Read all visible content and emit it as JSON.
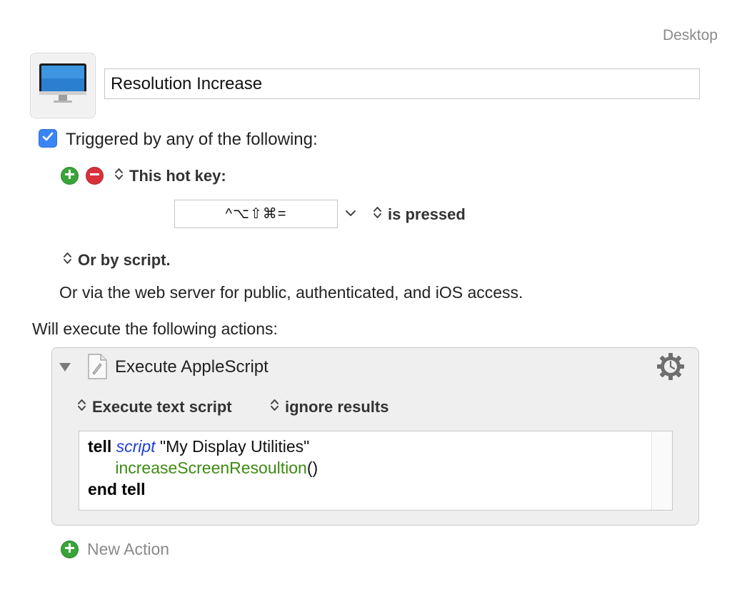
{
  "group": {
    "label": "Desktop"
  },
  "macro": {
    "name": "Resolution Increase",
    "icon": "monitor-icon"
  },
  "trigger": {
    "enabled": true,
    "label": "Triggered by any of the following:",
    "type_label": "This hot key:",
    "hotkey": "^⌥⇧⌘=",
    "condition_label": "is pressed",
    "script_label": "Or by script.",
    "webserver_text": "Or via the web server for public, authenticated, and iOS access."
  },
  "actions": {
    "label": "Will execute the following actions:",
    "items": [
      {
        "title": "Execute AppleScript",
        "mode_label": "Execute text script",
        "results_label": "ignore results",
        "code": {
          "line1": {
            "kw": "tell",
            "scriptkw": "script",
            "rest": " \"My Display Utilities\""
          },
          "line2": {
            "indent": "      ",
            "fn": "increaseScreenResoultion",
            "rest": "()"
          },
          "line3": {
            "kw": "end tell"
          }
        }
      }
    ],
    "new_action_label": "New Action"
  },
  "colors": {
    "accent": "#3a85f5",
    "add_green": "#3aa33a",
    "remove_red": "#d8313a",
    "keyword_blue": "#1f3fd6",
    "function_green": "#3d8a12"
  }
}
